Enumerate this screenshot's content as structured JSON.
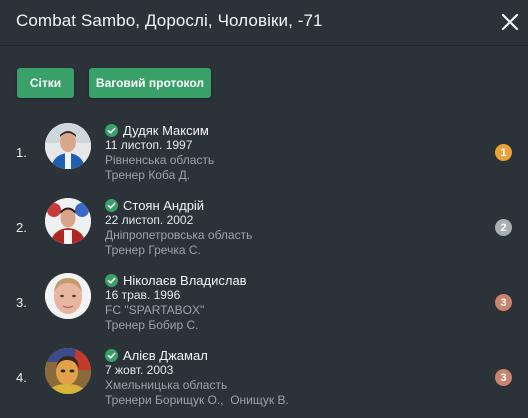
{
  "header": {
    "title": "Combat Sambo, Дорослі, Чоловіки, -71",
    "close_icon": "close-icon"
  },
  "toolbar": {
    "grids_label": "Сітки",
    "weigh_label": "Ваговий протокол"
  },
  "colors": {
    "background": "#2b3338",
    "button": "#3aa06a",
    "verified": "#3aa06a",
    "gold": "#e8a23a",
    "silver": "#a8aeb2",
    "bronze": "#c8846e"
  },
  "athletes": [
    {
      "place": "1.",
      "name": "Дудяк Максим",
      "dob": "11 листоп. 1997",
      "region": "Рівненська область",
      "coach": "Тренер Коба Д.",
      "medal": "1",
      "medal_color": "#e8a23a",
      "verified_icon": "check-circle-icon"
    },
    {
      "place": "2.",
      "name": "Стоян Андрій",
      "dob": "22 листоп. 2002",
      "region": "Дніпропетровська область",
      "coach": "Тренер Гречка С.",
      "medal": "2",
      "medal_color": "#a8aeb2",
      "verified_icon": "check-circle-icon"
    },
    {
      "place": "3.",
      "name": "Ніколаєв Владислав",
      "dob": "16 трав. 1996",
      "region": "FC \"SPARTABOX\"",
      "coach": "Тренер Бобир С.",
      "medal": "3",
      "medal_color": "#c8846e",
      "verified_icon": "check-circle-icon"
    },
    {
      "place": "4.",
      "name": "Алієв Джамал",
      "dob": "7 жовт. 2003",
      "region": "Хмельницька область",
      "coach": "Тренери Борищук О.,  Онищук В.",
      "medal": "3",
      "medal_color": "#c8846e",
      "verified_icon": "check-circle-icon"
    }
  ]
}
